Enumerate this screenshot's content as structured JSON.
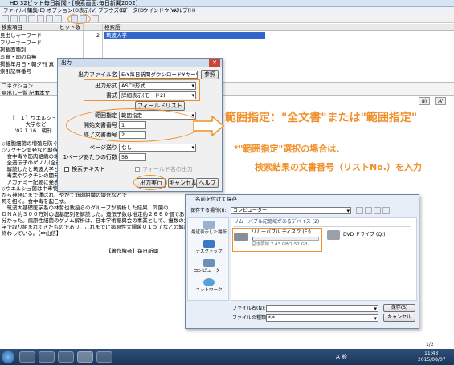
{
  "window": {
    "title": "HD 32ビット毎日新聞 - [検索画面:毎日新聞2002]",
    "menu": [
      "ファイル(F)",
      "編集(E)",
      "オプション(O)",
      "表示(V)",
      "ブラウズ(B)",
      "データ(D)",
      "ウインドウ(W)",
      "ヘルプ(H)"
    ]
  },
  "search_table": {
    "headers": [
      "検索項目",
      "ヒット数",
      "検索語"
    ],
    "rows": [
      "見出しキーワード",
      "フリーキーワード",
      "掲載面種別",
      "写真・図の有無",
      "掲載年月日・朝夕刊 真",
      "索引記事番号"
    ],
    "hit_count": "2",
    "query": "筑波大学"
  },
  "result_tabs": {
    "pane_label": "コネクション",
    "tab_headline": "見出し一覧",
    "tab_article": "記事本文",
    "right_buttons": [
      "前",
      "次"
    ]
  },
  "article": {
    "lines": [
      "［　１］ウエルシュ菌の…",
      "　　　大学など",
      "　'02.1.16　朝刊",
      "",
      "◇細胞細菌の増殖を防ぐ",
      "◇ワクチン開発など期待",
      "　食中毒や筋肉組織の壊",
      "　全遺伝子のゲノム(全遺伝",
      "　解読したと筑波大学と東",
      "　毒素やワクチンの開発に",
      "　アカデミー紀要に発表",
      "◇ウエルシュ菌は中毒物質",
      "から神経にまで運ばれ、やがて筋肉組織の壊死などで",
      "死を招く。食中毒を起こす。",
      "　筑波大基礎医学系の林哲也教授らのグループが解析した結果、同菌の",
      "ＤＮＡ約３００万対の塩基配列を解読した。遺伝子数は推定約２６６０個であることが",
      "分かった。病原性細菌のゲノム解析は、日本学術振興会の事業として、複数の大",
      "学で取り組まれてきたものであり、これまでに病原性大腸菌０１５７などの解読を",
      "終わっている。【中山信】"
    ],
    "footer": "【著作権者】毎日新聞"
  },
  "output_dialog": {
    "title": "出力",
    "filename_label": "出力ファイル名",
    "filename_value": "E:¥毎日新聞ダウンロード¥キーワ",
    "browse_button": "参照",
    "format_label": "出力形式",
    "format_value": "ASCII形式",
    "style_label": "書式",
    "style_value": "詳細表示(モード2)",
    "fieldlist_button": "フィールドリスト",
    "range_label": "範囲指定",
    "range_value": "範囲指定",
    "start_label": "開始文書番号",
    "start_value": "1",
    "end_label": "終了文書番号",
    "end_value": "2",
    "pagebreak_label": "ページ送り",
    "pagebreak_value": "なし",
    "lines_label": "1ページあたりの行数",
    "lines_value": "58",
    "search_text_label": "検索テキスト",
    "field_name_label": "フィールド名の出力",
    "run_button": "出力実行",
    "cancel_button": "キャンセル",
    "help_button": "ヘルプ",
    "close_symbol": "✕"
  },
  "annotations": {
    "callout1": "範囲指定：\"全文書\"または\"範囲指定\"",
    "callout2": "*\"範囲指定\"選択の場合は、",
    "callout3": "検索結果の文書番号（リストNo.）を入力"
  },
  "save_dialog": {
    "title": "名前を付けて保存",
    "location_label": "保存する場所(I):",
    "location_value": "コンピューター",
    "section_label": "リムーバブル記憶域があるデバイス (2)",
    "drive1_name": "リムーバブル ディスク (E:)",
    "drive1_space": "空き領域 7.43 GB/7.52 GB",
    "drive1_fill": 0.01,
    "drive2_name": "DVD ドライブ (Q:)",
    "nav": [
      "最近表示した場所",
      "デスクトップ",
      "コンピューター",
      "ネットワーク"
    ],
    "filename_label": "ファイル名(N):",
    "filetype_label": "ファイルの種類(T):",
    "filetype_value": "*.*",
    "save_button": "保存(S)",
    "cancel_button": "キャンセル"
  },
  "taskbar": {
    "page_indicator": "1/2",
    "time": "11:43",
    "date": "2015/08/07",
    "ime_label": "A 般"
  },
  "colors": {
    "accent": "#f0902a",
    "selection": "#3366cc"
  }
}
